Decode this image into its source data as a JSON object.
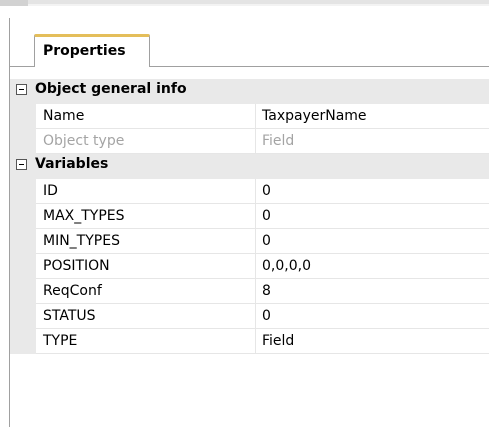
{
  "panel": {
    "tab_label": "Properties"
  },
  "categories": [
    {
      "label": "Object general info",
      "properties": [
        {
          "name": "Name",
          "value": "TaxpayerName"
        },
        {
          "name": "Object type",
          "value": "Field"
        }
      ]
    },
    {
      "label": "Variables",
      "properties": [
        {
          "name": "ID",
          "value": "0"
        },
        {
          "name": "MAX_TYPES",
          "value": "0"
        },
        {
          "name": "MIN_TYPES",
          "value": "0"
        },
        {
          "name": "POSITION",
          "value": "0,0,0,0"
        },
        {
          "name": "ReqConf",
          "value": "8"
        },
        {
          "name": "STATUS",
          "value": "0"
        },
        {
          "name": "TYPE",
          "value": "Field"
        }
      ]
    }
  ],
  "icons": {
    "collapse": "minus-box-icon"
  },
  "colors": {
    "tab_accent": "#e4be5a",
    "category_bg": "#e9e9e9",
    "readonly_text": "#a4a4a4"
  }
}
